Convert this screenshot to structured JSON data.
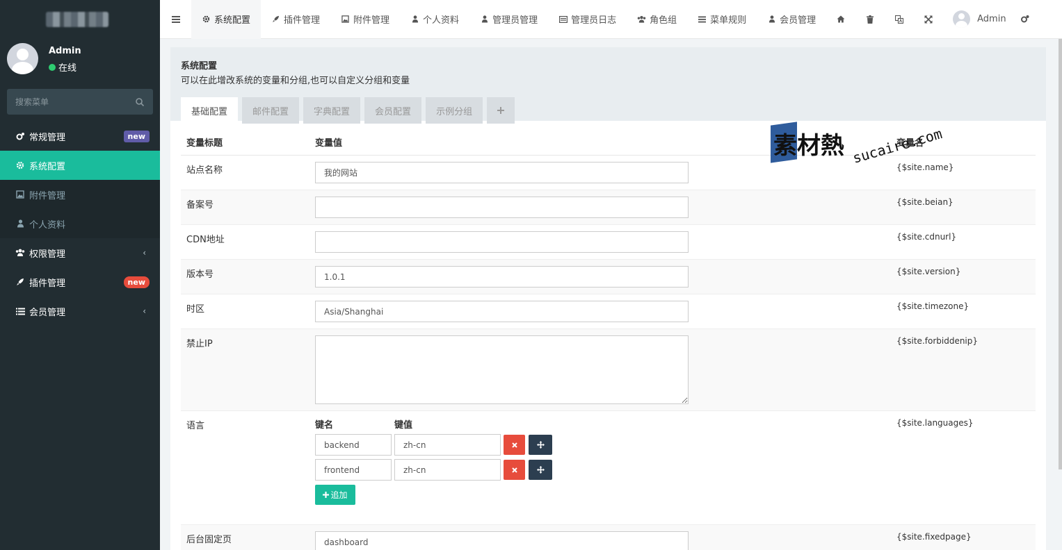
{
  "sidebar": {
    "user": {
      "name": "Admin",
      "status": "在线"
    },
    "search": {
      "placeholder": "搜索菜单"
    },
    "items": [
      {
        "label": "常规管理",
        "icon": "cogs-icon",
        "badge": "new"
      },
      {
        "label": "系统配置",
        "icon": "gear-icon"
      },
      {
        "label": "附件管理",
        "icon": "image-icon"
      },
      {
        "label": "个人资料",
        "icon": "user-icon"
      },
      {
        "label": "权限管理",
        "icon": "group-icon"
      },
      {
        "label": "插件管理",
        "icon": "rocket-icon",
        "badge": "new"
      },
      {
        "label": "会员管理",
        "icon": "list-icon"
      }
    ]
  },
  "topbar": {
    "tabs": [
      {
        "label": "系统配置",
        "icon": "gear-icon"
      },
      {
        "label": "插件管理",
        "icon": "rocket-icon"
      },
      {
        "label": "附件管理",
        "icon": "image-icon"
      },
      {
        "label": "个人资料",
        "icon": "user-icon"
      },
      {
        "label": "管理员管理",
        "icon": "user-icon"
      },
      {
        "label": "管理员日志",
        "icon": "list-alt-icon"
      },
      {
        "label": "角色组",
        "icon": "group-icon"
      },
      {
        "label": "菜单规则",
        "icon": "bars-icon"
      },
      {
        "label": "会员管理",
        "icon": "user-icon"
      }
    ],
    "admin": "Admin"
  },
  "panel": {
    "title": "系统配置",
    "desc": "可以在此增改系统的变量和分组,也可以自定义分组和变量",
    "tabs": [
      "基础配置",
      "邮件配置",
      "字典配置",
      "会员配置",
      "示例分组"
    ]
  },
  "table": {
    "headers": {
      "title": "变量标题",
      "value": "变量值",
      "name": "变量名"
    },
    "rows": [
      {
        "title": "站点名称",
        "value": "我的网站",
        "name": "{$site.name}"
      },
      {
        "title": "备案号",
        "value": "",
        "name": "{$site.beian}"
      },
      {
        "title": "CDN地址",
        "value": "",
        "name": "{$site.cdnurl}"
      },
      {
        "title": "版本号",
        "value": "1.0.1",
        "name": "{$site.version}"
      },
      {
        "title": "时区",
        "value": "Asia/Shanghai",
        "name": "{$site.timezone}"
      },
      {
        "title": "禁止IP",
        "value": "",
        "name": "{$site.forbiddenip}"
      },
      {
        "title": "语言",
        "name": "{$site.languages}"
      },
      {
        "title": "后台固定页",
        "value": "dashboard",
        "name": "{$site.fixedpage}"
      }
    ],
    "languages": {
      "key_header": "键名",
      "value_header": "键值",
      "pairs": [
        {
          "key": "backend",
          "value": "zh-cn"
        },
        {
          "key": "frontend",
          "value": "zh-cn"
        }
      ],
      "add_label": "追加"
    }
  },
  "watermark": {
    "cn": "素材熱",
    "en": "sucaire.com"
  },
  "colors": {
    "sidebar": "#222d32",
    "accent": "#1abc9c",
    "danger": "#e74c3c",
    "dark": "#2c3e50",
    "badge_purple": "#605ca8"
  }
}
